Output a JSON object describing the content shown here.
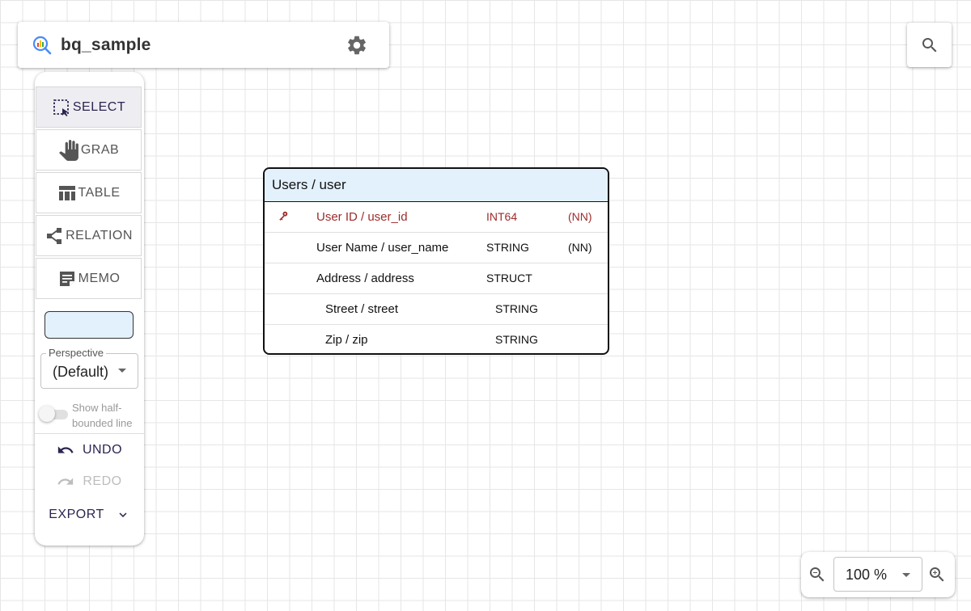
{
  "header": {
    "title": "bq_sample",
    "logo_icon": "bigquery-logo",
    "settings_icon": "gear-icon"
  },
  "search": {
    "icon": "search-icon"
  },
  "toolbar": {
    "tools": [
      {
        "label": "SELECT",
        "icon": "select-icon",
        "active": true
      },
      {
        "label": "GRAB",
        "icon": "hand-icon",
        "active": false
      },
      {
        "label": "TABLE",
        "icon": "table-icon",
        "active": false
      },
      {
        "label": "RELATION",
        "icon": "relation-icon",
        "active": false
      },
      {
        "label": "MEMO",
        "icon": "memo-icon",
        "active": false
      }
    ],
    "color_swatch": "#e3f1fc",
    "perspective": {
      "label": "Perspective",
      "value": "(Default)"
    },
    "half_bounded": {
      "label": "Show half-bounded line",
      "checked": false
    },
    "undo_label": "UNDO",
    "redo_label": "REDO",
    "export_label": "EXPORT"
  },
  "table": {
    "title": "Users / user",
    "header_color": "#e3f1fc",
    "rows": [
      {
        "name": "User ID / user_id",
        "type": "INT64",
        "nn": "(NN)",
        "primary_key": true,
        "indent": 0
      },
      {
        "name": "User Name / user_name",
        "type": "STRING",
        "nn": "(NN)",
        "primary_key": false,
        "indent": 0
      },
      {
        "name": "Address / address",
        "type": "STRUCT",
        "nn": "",
        "primary_key": false,
        "indent": 0
      },
      {
        "name": "Street / street",
        "type": "STRING",
        "nn": "",
        "primary_key": false,
        "indent": 1
      },
      {
        "name": "Zip / zip",
        "type": "STRING",
        "nn": "",
        "primary_key": false,
        "indent": 1
      }
    ]
  },
  "zoom": {
    "value": "100 %"
  }
}
